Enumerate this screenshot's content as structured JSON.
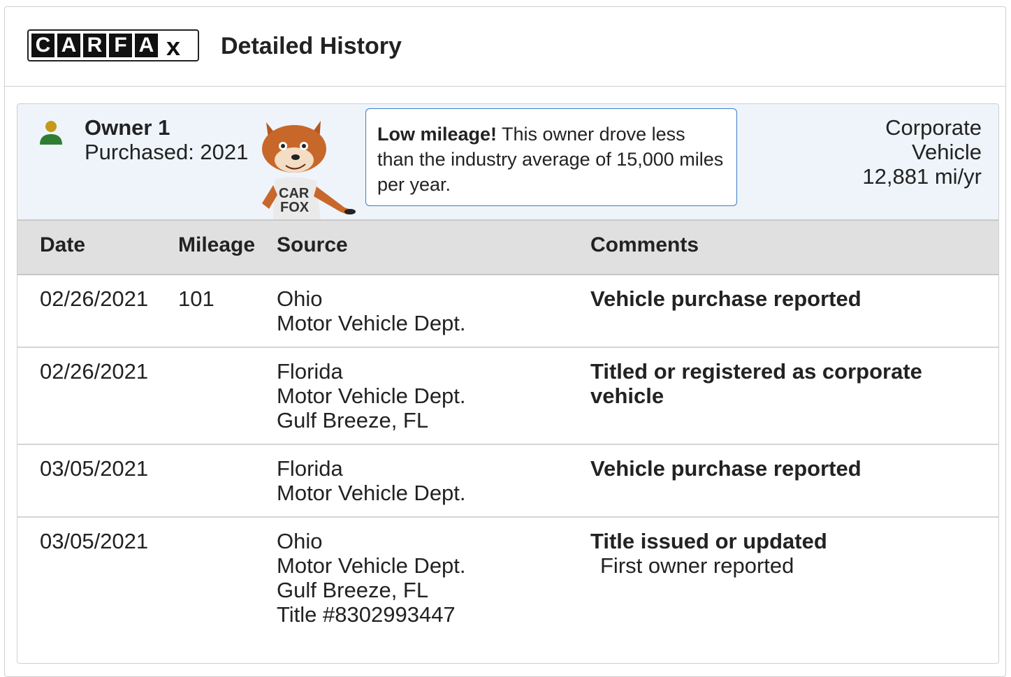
{
  "header": {
    "logo_letters": [
      "C",
      "A",
      "R",
      "F",
      "A",
      "x"
    ],
    "title": "Detailed History"
  },
  "owner": {
    "name": "Owner 1",
    "purchased": "Purchased: 2021",
    "fox_shirt": [
      "CAR",
      "FOX"
    ],
    "callout_bold": "Low mileage!",
    "callout_text": " This owner drove less than the industry average of 15,000 miles per year.",
    "type_line1": "Corporate",
    "type_line2": "Vehicle",
    "miles_per_year": "12,881 mi/yr",
    "icon_colors": {
      "head": "#c49a1a",
      "body": "#2e7d32"
    }
  },
  "table": {
    "columns": {
      "date": "Date",
      "mileage": "Mileage",
      "source": "Source",
      "comments": "Comments"
    },
    "rows": [
      {
        "date": "02/26/2021",
        "mileage": "101",
        "source": [
          "Ohio",
          "Motor Vehicle Dept."
        ],
        "comment_title": "Vehicle purchase reported",
        "comment_sub": ""
      },
      {
        "date": "02/26/2021",
        "mileage": "",
        "source": [
          "Florida",
          "Motor Vehicle Dept.",
          "Gulf Breeze, FL"
        ],
        "comment_title": "Titled or registered as corporate vehicle",
        "comment_sub": ""
      },
      {
        "date": "03/05/2021",
        "mileage": "",
        "source": [
          "Florida",
          "Motor Vehicle Dept."
        ],
        "comment_title": "Vehicle purchase reported",
        "comment_sub": ""
      },
      {
        "date": "03/05/2021",
        "mileage": "",
        "source": [
          "Ohio",
          "Motor Vehicle Dept.",
          "Gulf Breeze, FL",
          "Title #8302993447"
        ],
        "comment_title": "Title issued or updated",
        "comment_sub": "First owner reported"
      }
    ]
  }
}
